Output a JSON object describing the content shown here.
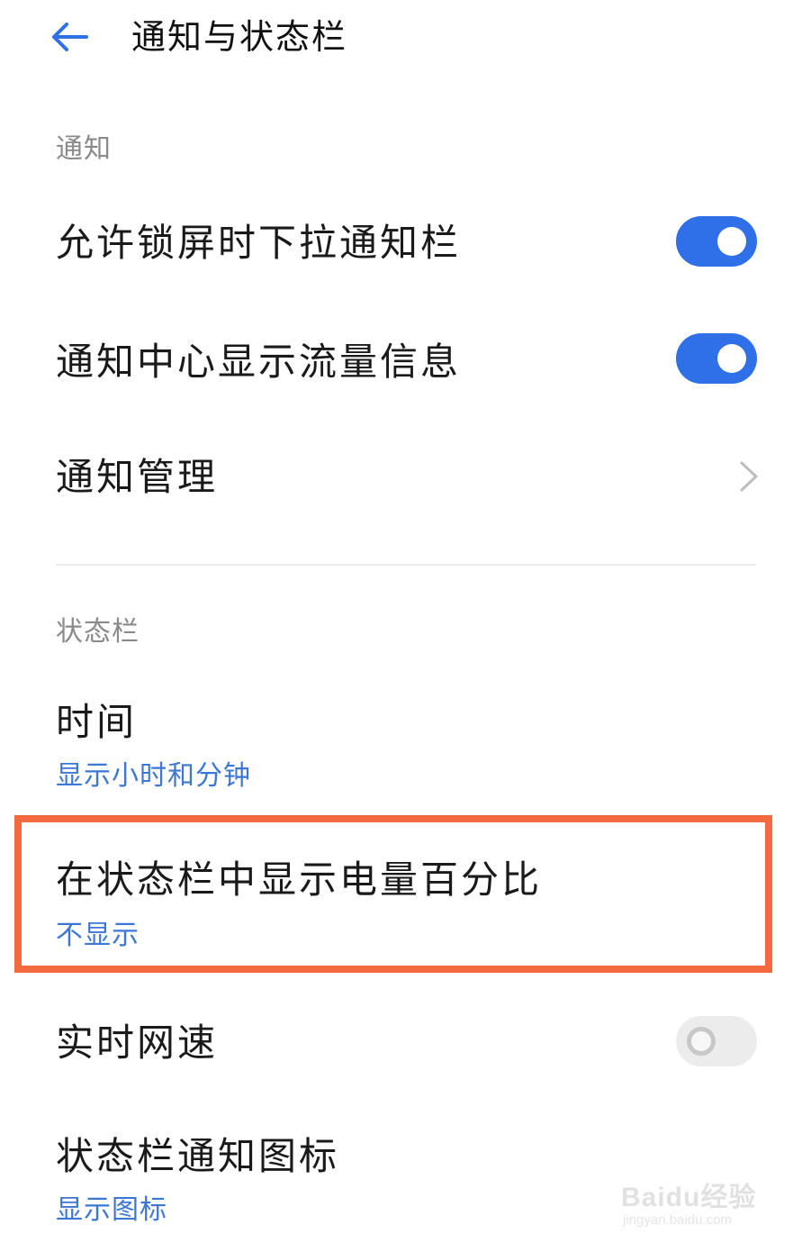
{
  "header": {
    "title": "通知与状态栏",
    "back_icon": "arrow-left-icon"
  },
  "sections": {
    "notification_label": "通知",
    "statusbar_label": "状态栏"
  },
  "rows": {
    "lock_pull_down": {
      "title": "允许锁屏时下拉通知栏",
      "enabled": true
    },
    "traffic_info": {
      "title": "通知中心显示流量信息",
      "enabled": true
    },
    "notification_mgmt": {
      "title": "通知管理",
      "icon": "chevron-right-icon"
    },
    "time": {
      "title": "时间",
      "subtitle": "显示小时和分钟"
    },
    "battery_percent": {
      "title": "在状态栏中显示电量百分比",
      "subtitle": "不显示"
    },
    "net_speed": {
      "title": "实时网速",
      "enabled": false
    },
    "statusbar_icons": {
      "title": "状态栏通知图标",
      "subtitle": "显示图标"
    }
  },
  "colors": {
    "accent": "#2f6fe8",
    "subtitle": "#3d77d6",
    "highlight": "#f26a3d"
  },
  "watermark": {
    "text": "Baidu经验",
    "url_text": "jingyan.baidu.com"
  }
}
